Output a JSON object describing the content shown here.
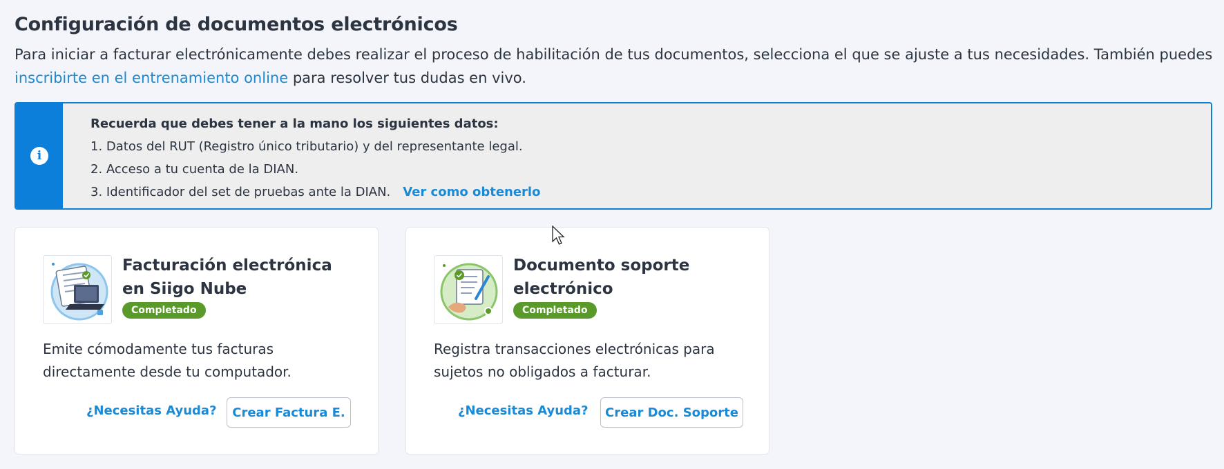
{
  "header": {
    "title": "Configuración de documentos electrónicos",
    "intro_text": "Para iniciar a facturar electrónicamente debes realizar el proceso de habilitación de tus documentos, selecciona el que se ajuste a tus necesidades. También puedes ",
    "intro_link": "inscribirte en el entrenamiento online",
    "intro_tail": " para resolver tus dudas en vivo."
  },
  "alert": {
    "icon": "info-icon",
    "heading": "Recuerda que debes tener a la mano los siguientes datos:",
    "items": [
      "1. Datos del RUT (Registro único tributario) y del representante legal.",
      "2. Acceso a tu cuenta de la DIAN.",
      "3. Identificador del set de pruebas ante la DIAN."
    ],
    "link": "Ver como obtenerlo"
  },
  "cards": [
    {
      "icon": "invoice-laptop-icon",
      "title": "Facturación electrónica en Siigo Nube",
      "badge": "Completado",
      "description": "Emite cómodamente tus facturas directamente desde tu computador.",
      "help_link": "¿Necesitas Ayuda?",
      "button": "Crear Factura E."
    },
    {
      "icon": "support-document-icon",
      "title": "Documento soporte electrónico",
      "badge": "Completado",
      "description": "Registra transacciones electrónicas para sujetos no obligados a facturar.",
      "help_link": "¿Necesitas Ayuda?",
      "button": "Crear Doc. Soporte"
    }
  ],
  "colors": {
    "accent": "#1a8ad6",
    "alert_bar": "#0b7fd9",
    "badge": "#5a9a2b"
  }
}
